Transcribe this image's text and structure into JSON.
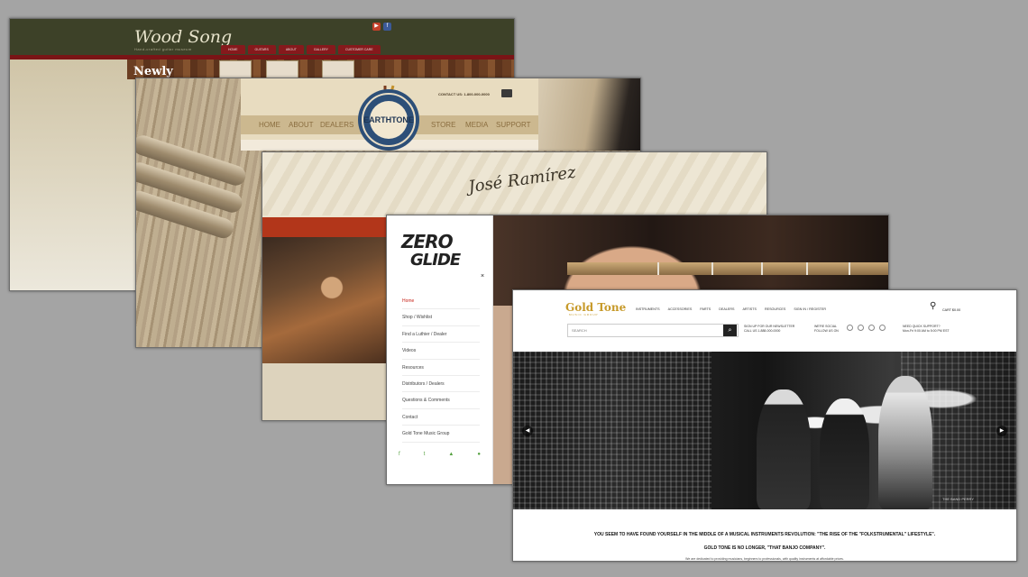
{
  "wood_song": {
    "logo": "Wood Song",
    "tagline": "Hand-crafted guitar museum",
    "newly": "Newly",
    "tabs": [
      "HOME",
      "GUITARS",
      "ABOUT",
      "GALLERY",
      "CUSTOMER CARE"
    ]
  },
  "earthtone": {
    "contact": "CONTACT US: 1-800-000-0000",
    "badge": "EARTHTONE",
    "nav": [
      "HOME",
      "ABOUT",
      "DEALERS",
      "STORE",
      "MEDIA",
      "SUPPORT"
    ]
  },
  "jose_ramirez": {
    "logo": "José Ramírez"
  },
  "zero_glide": {
    "logo_line1": "ZERO",
    "logo_line2": "GLIDE",
    "close": "×",
    "menu": [
      "Home",
      "Shop / Wishlist",
      "Find a Luthier / Dealer",
      "Videos",
      "Resources",
      "Distributors / Dealers",
      "Questions & Comments",
      "Contact",
      "Gold Tone Music Group"
    ],
    "footer_icons": [
      "f",
      "t",
      "▲",
      "●"
    ]
  },
  "gold_tone": {
    "logo": "Gold Tone",
    "logo_sub": "MUSIC GROUP",
    "nav": [
      "INSTRUMENTS",
      "ACCESSORIES",
      "PARTS",
      "DEALERS",
      "ARTISTS",
      "RESOURCES",
      "SIGN IN / REGISTER"
    ],
    "cart_label": "CART $0.00",
    "search_placeholder": "SEARCH",
    "info1_title": "SIGN UP FOR OUR NEWSLETTER",
    "info1_sub": "CALL US 1-888-000-0000",
    "info2_title": "WE'RE SOCIAL",
    "info2_sub": "FOLLOW US ON",
    "info3_title": "NEED QUICK SUPPORT?",
    "info3_sub": "Mon-Fri 9:00 AM to 5:00 PM EST",
    "hero_band": "THE BAND PERRY",
    "tagline1": "YOU SEEM TO HAVE FOUND YOURSELF IN THE MIDDLE OF A MUSICAL INSTRUMENTS REVOLUTION: \"THE RISE OF THE \"FOLKSTRUMENTAL\" LIFESTYLE\".",
    "tagline2": "GOLD TONE IS NO LONGER, \"THAT BANJO COMPANY\".",
    "tagline3": "We are dedicated to providing musicians, beginners to professionals, with quality instruments at affordable prices."
  }
}
